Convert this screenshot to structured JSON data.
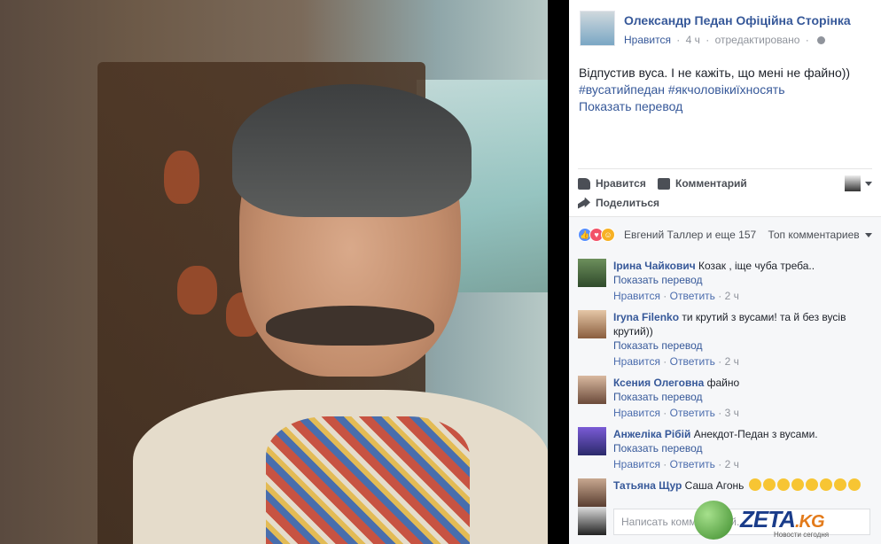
{
  "post": {
    "page_name": "Олександр Педан Офіційна Сторінка",
    "meta_like": "Нравится",
    "meta_time": "4 ч",
    "meta_edited": "отредактировано",
    "text": "Відпустив вуса. І не кажіть, що мені не файно))",
    "hashtags": "#вусатийпедан #якчоловікиїхносять",
    "translate": "Показать перевод"
  },
  "actions": {
    "like": "Нравится",
    "comment": "Комментарий",
    "share": "Поделиться"
  },
  "reactions": {
    "summary": "Евгений Таллер и еще 157",
    "top_comments": "Топ комментариев"
  },
  "comments": [
    {
      "author": "Ірина Чайкович",
      "text": "Козак , іще чуба треба..",
      "translate": "Показать перевод",
      "like": "Нравится",
      "reply": "Ответить",
      "time": "2 ч"
    },
    {
      "author": "Iryna Filenko",
      "text": "ти крутий з вусами! та й без вусів крутий))",
      "translate": "Показать перевод",
      "like": "Нравится",
      "reply": "Ответить",
      "time": "2 ч"
    },
    {
      "author": "Ксения Олеговна",
      "text": "файно",
      "translate": "Показать перевод",
      "like": "Нравится",
      "reply": "Ответить",
      "time": "3 ч"
    },
    {
      "author": "Анжеліка Рібій",
      "text": "Анекдот-Педан з вусами.",
      "translate": "Показать перевод",
      "like": "Нравится",
      "reply": "Ответить",
      "time": "2 ч"
    },
    {
      "author": "Татьяна Щур",
      "text": "Саша Агонь"
    }
  ],
  "write_placeholder": "Написать комментарий...",
  "watermark": {
    "brand": "ZETA",
    "tld": ".KG",
    "tagline": "Новости сегодня"
  },
  "icons": [
    "globe-icon",
    "like-icon",
    "comment-icon",
    "share-icon",
    "caret-down-icon"
  ]
}
